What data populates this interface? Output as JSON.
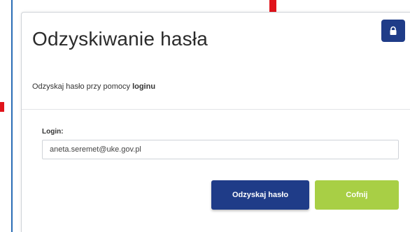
{
  "dialog": {
    "title": "Odzyskiwanie hasła",
    "subtitle_prefix": "Odzyskaj hasło przy pomocy ",
    "subtitle_bold": "loginu",
    "login_label": "Login:",
    "login_value": "aneta.seremet@uke.gov.pl",
    "recover_button": "Odzyskaj hasło",
    "cancel_button": "Cofnij",
    "lock_icon": "lock-icon"
  },
  "colors": {
    "primary": "#1f3c88",
    "cancel": "#a8cf45",
    "marker": "#e0141b",
    "border_line": "#2a6db5"
  }
}
